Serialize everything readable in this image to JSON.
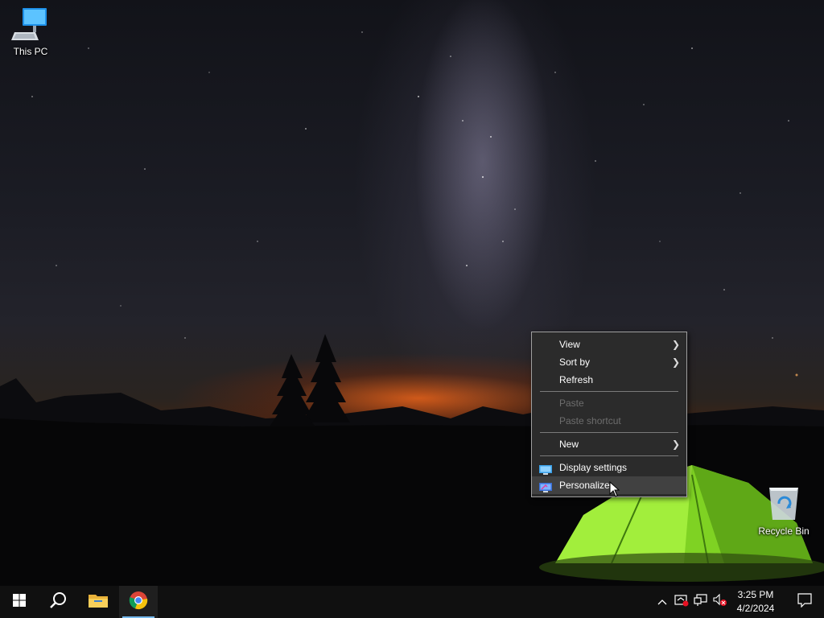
{
  "desktop": {
    "icons": [
      {
        "label": "This PC",
        "icon": "computer-icon"
      },
      {
        "label": "Recycle Bin",
        "icon": "recycle-bin-icon"
      }
    ]
  },
  "context_menu": {
    "items": [
      {
        "label": "View",
        "has_submenu": true,
        "enabled": true
      },
      {
        "label": "Sort by",
        "has_submenu": true,
        "enabled": true
      },
      {
        "label": "Refresh",
        "has_submenu": false,
        "enabled": true
      },
      {
        "label": "Paste",
        "has_submenu": false,
        "enabled": false
      },
      {
        "label": "Paste shortcut",
        "has_submenu": false,
        "enabled": false
      },
      {
        "label": "New",
        "has_submenu": true,
        "enabled": true
      },
      {
        "label": "Display settings",
        "icon": "display-settings-icon",
        "enabled": true
      },
      {
        "label": "Personalize",
        "icon": "personalize-icon",
        "enabled": true,
        "hovered": true
      }
    ]
  },
  "taskbar": {
    "buttons": [
      "windows-start-icon",
      "search-icon",
      "file-explorer-icon",
      "chrome-icon"
    ],
    "active_app": "chrome-icon",
    "tray_icons": [
      "chevron-up-icon",
      "security-icon",
      "network-icon",
      "volume-muted-icon"
    ],
    "clock": {
      "time": "3:25 PM",
      "date": "4/2/2024"
    }
  },
  "colors": {
    "taskbar_bg": "#101010",
    "menu_bg": "#2b2b2b",
    "menu_hover": "#414141",
    "accent": "#76b9ed",
    "tent_green": "#8fe32a"
  }
}
